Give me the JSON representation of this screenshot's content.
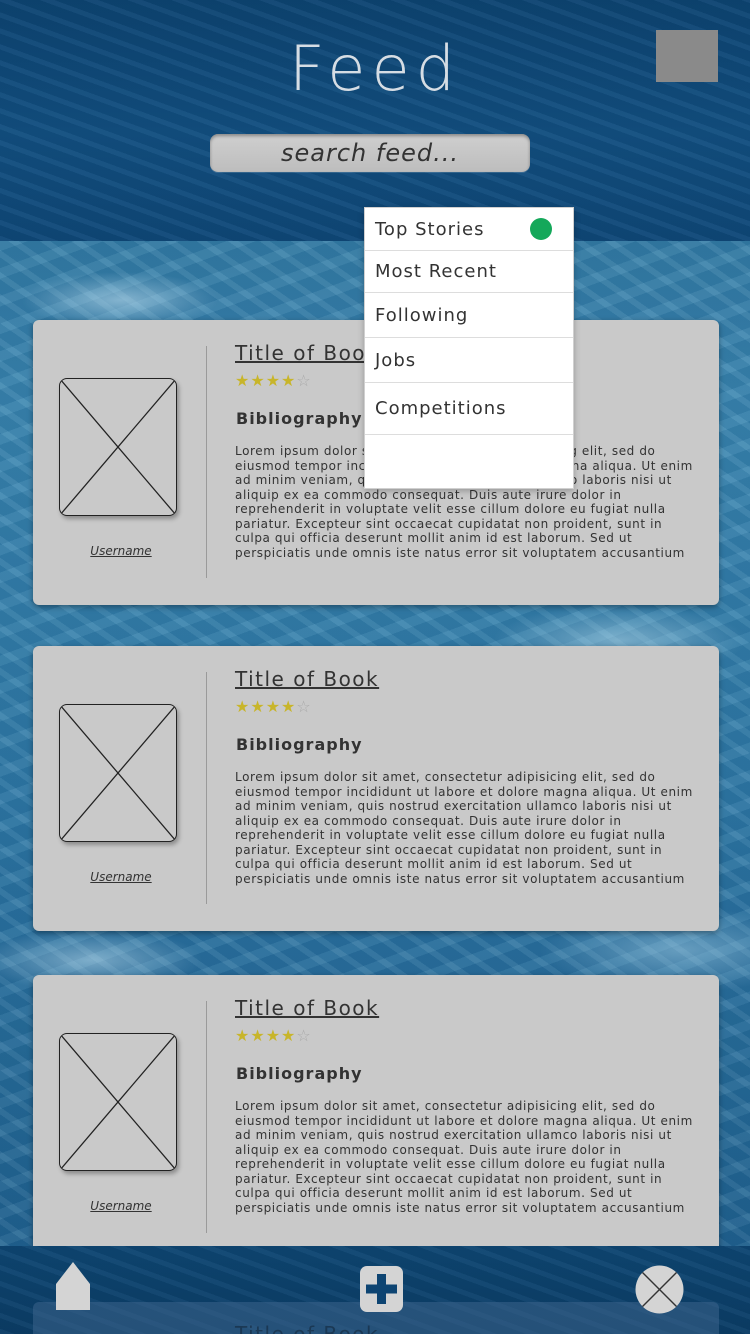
{
  "header": {
    "title": "Feed",
    "search": {
      "placeholder": "search feed..."
    }
  },
  "dropdown": {
    "items": [
      {
        "label": "Top Stories",
        "selected": true
      },
      {
        "label": "Most Recent"
      },
      {
        "label": "Following"
      },
      {
        "label": "Jobs"
      },
      {
        "label": "Competitions"
      },
      {
        "label": ""
      }
    ],
    "selected_indicator_color": "#14a85a"
  },
  "posts": [
    {
      "title": "Title of Book",
      "rating": 4,
      "max_rating": 5,
      "section": "Bibliography",
      "username": "Username",
      "body": "Lorem ipsum dolor sit amet, consectetur adipisicing elit, sed do\neiusmod tempor incididunt ut labore et dolore magna aliqua. Ut enim\nad minim veniam, quis nostrud exercitation ullamco laboris nisi ut\naliquip ex ea commodo consequat. Duis aute irure dolor in\nreprehenderit in voluptate velit esse cillum dolore eu fugiat nulla\npariatur. Excepteur sint occaecat cupidatat non proident, sunt in\nculpa qui officia deserunt mollit anim id est laborum. Sed ut\nperspiciatis unde omnis iste natus error sit voluptatem accusantium"
    },
    {
      "title": "Title of Book",
      "rating": 4,
      "max_rating": 5,
      "section": "Bibliography",
      "username": "Username",
      "body": "Lorem ipsum dolor sit amet, consectetur adipisicing elit, sed do\neiusmod tempor incididunt ut labore et dolore magna aliqua. Ut enim\nad minim veniam, quis nostrud exercitation ullamco laboris nisi ut\naliquip ex ea commodo consequat. Duis aute irure dolor in\nreprehenderit in voluptate velit esse cillum dolore eu fugiat nulla\npariatur. Excepteur sint occaecat cupidatat non proident, sunt in\nculpa qui officia deserunt mollit anim id est laborum. Sed ut\nperspiciatis unde omnis iste natus error sit voluptatem accusantium"
    },
    {
      "title": "Title of Book",
      "rating": 4,
      "max_rating": 5,
      "section": "Bibliography",
      "username": "Username",
      "body": "Lorem ipsum dolor sit amet, consectetur adipisicing elit, sed do\neiusmod tempor incididunt ut labore et dolore magna aliqua. Ut enim\nad minim veniam, quis nostrud exercitation ullamco laboris nisi ut\naliquip ex ea commodo consequat. Duis aute irure dolor in\nreprehenderit in voluptate velit esse cillum dolore eu fugiat nulla\npariatur. Excepteur sint occaecat cupidatat non proident, sunt in\nculpa qui officia deserunt mollit anim id est laborum. Sed ut\nperspiciatis unde omnis iste natus error sit voluptatem accusantium"
    },
    {
      "title": "Title of Book"
    }
  ],
  "bottom_nav": {
    "icons": [
      "home-icon",
      "add-icon",
      "profile-icon"
    ]
  },
  "colors": {
    "header_bg": "#0f4878",
    "card_bg": "#c9c9c9",
    "star_on": "#c8b52a",
    "star_off": "#aaaaaa",
    "corner_square": "#8a8a8a"
  }
}
